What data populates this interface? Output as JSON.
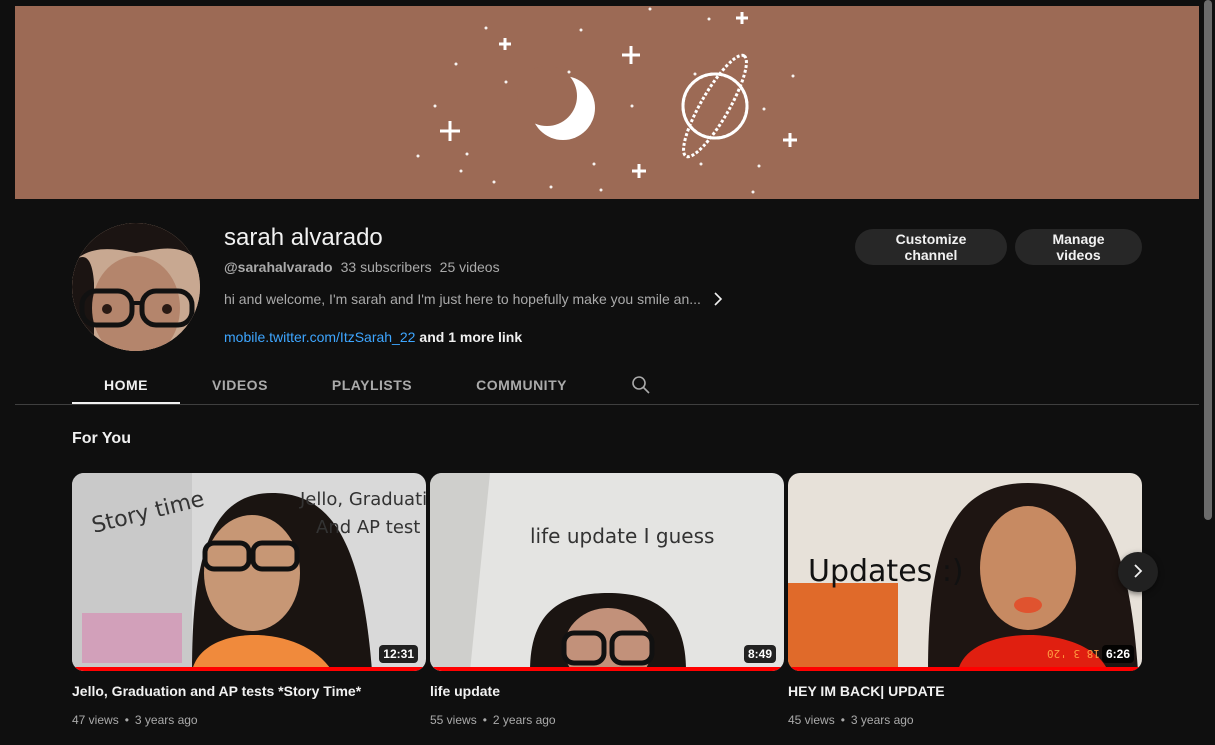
{
  "channel": {
    "name": "sarah alvarado",
    "handle": "@sarahalvarado",
    "subscribers": "33 subscribers",
    "videos_count": "25 videos",
    "description": "hi and welcome, I'm sarah and I'm just here to hopefully make you smile an...",
    "link_text": "mobile.twitter.com/ItzSarah_22",
    "more_links": "and 1 more link"
  },
  "buttons": {
    "customize": "Customize channel",
    "manage": "Manage videos"
  },
  "tabs": [
    {
      "label": "Home",
      "active": true
    },
    {
      "label": "Videos",
      "active": false
    },
    {
      "label": "Playlists",
      "active": false
    },
    {
      "label": "Community",
      "active": false
    }
  ],
  "section": {
    "title": "For You"
  },
  "videos": [
    {
      "title": "Jello, Graduation and AP tests *Story Time*",
      "views": "47 views",
      "age": "3 years ago",
      "duration": "12:31",
      "thumb_texts": [
        "Story time",
        "Jello, Graduation",
        "And AP test"
      ],
      "progress": 1.0
    },
    {
      "title": "life update",
      "views": "55 views",
      "age": "2 years ago",
      "duration": "8:49",
      "thumb_texts": [
        "life update I guess"
      ],
      "progress": 1.0
    },
    {
      "title": "HEY IM BACK| UPDATE",
      "views": "45 views",
      "age": "3 years ago",
      "duration": "6:26",
      "thumb_texts": [
        "Updates :)",
        "18 3 '20"
      ],
      "progress": 1.0
    }
  ],
  "icons": [
    "search-icon",
    "chevron-right-icon",
    "moon-icon",
    "planet-icon",
    "sparkle-icon"
  ],
  "colors": {
    "background": "#0f0f0f",
    "banner": "#9c6a55",
    "link": "#3ea6ff",
    "progress": "#ff0000",
    "button_bg": "#272727"
  }
}
